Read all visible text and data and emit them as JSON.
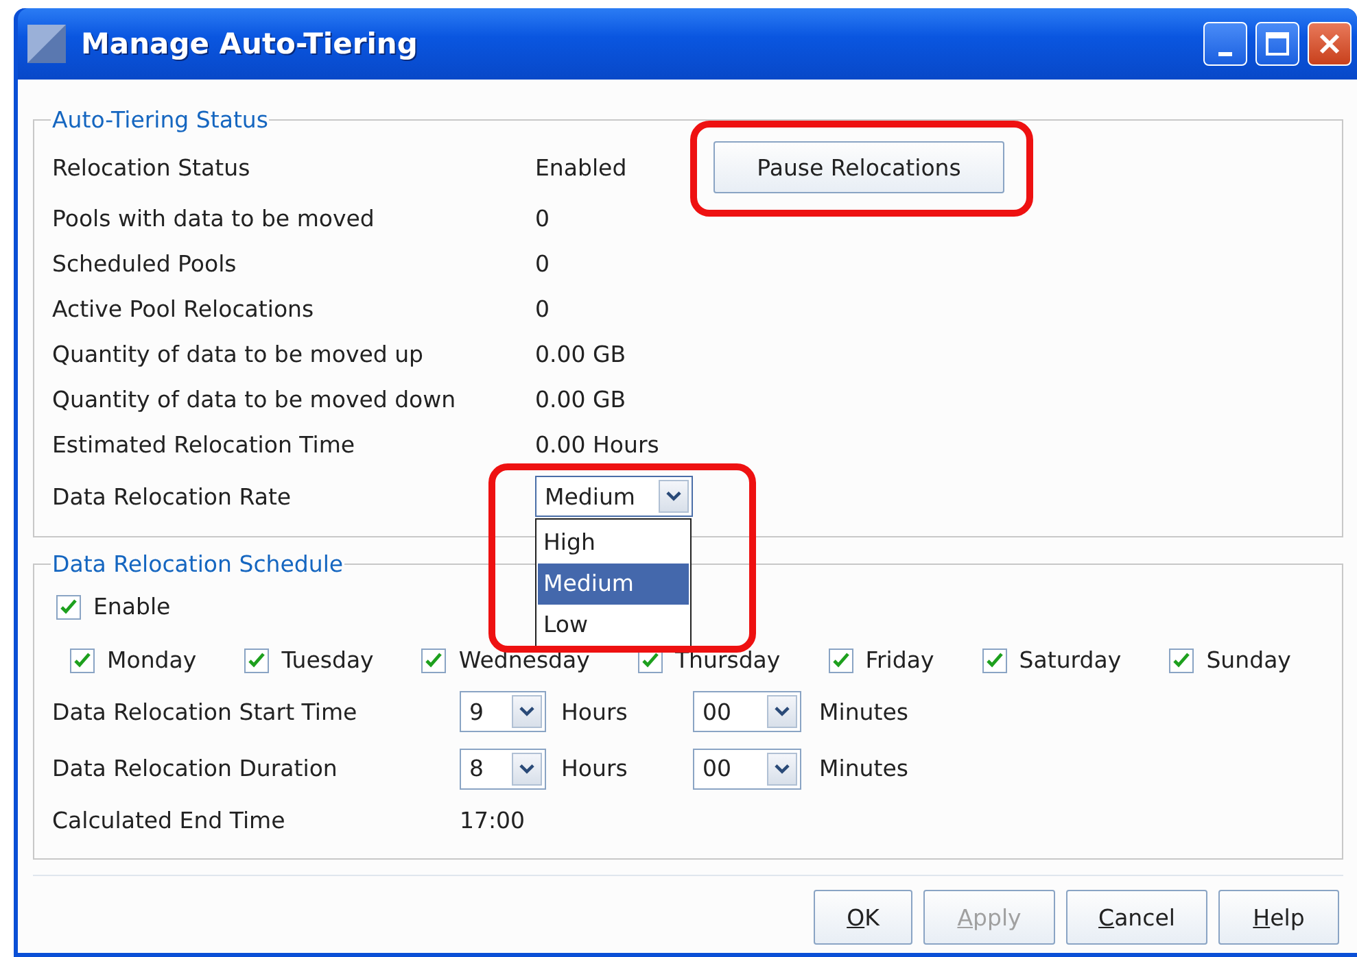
{
  "window": {
    "title": "Manage Auto-Tiering"
  },
  "status_group": {
    "title": "Auto-Tiering Status",
    "rows": [
      {
        "label": "Relocation Status",
        "value": "Enabled"
      },
      {
        "label": "Pools with data to be moved",
        "value": "0"
      },
      {
        "label": "Scheduled Pools",
        "value": "0"
      },
      {
        "label": "Active Pool Relocations",
        "value": "0"
      },
      {
        "label": "Quantity of data to be moved up",
        "value": "0.00 GB"
      },
      {
        "label": "Quantity of data to be moved down",
        "value": "0.00 GB"
      },
      {
        "label": "Estimated Relocation Time",
        "value": "0.00 Hours"
      }
    ],
    "pause_button": "Pause Relocations",
    "rate": {
      "label": "Data Relocation Rate",
      "value": "Medium",
      "expanded": true,
      "options": [
        {
          "label": "High",
          "selected": false
        },
        {
          "label": "Medium",
          "selected": true
        },
        {
          "label": "Low",
          "selected": false
        }
      ]
    }
  },
  "schedule": {
    "title": "Data Relocation Schedule",
    "enable": {
      "label": "Enable",
      "checked": true
    },
    "days": [
      {
        "label": "Monday",
        "checked": true
      },
      {
        "label": "Tuesday",
        "checked": true
      },
      {
        "label": "Wednesday",
        "checked": true
      },
      {
        "label": "Thursday",
        "checked": true
      },
      {
        "label": "Friday",
        "checked": true
      },
      {
        "label": "Saturday",
        "checked": true
      },
      {
        "label": "Sunday",
        "checked": true
      }
    ],
    "times": [
      {
        "label": "Data Relocation Start Time",
        "hours": "9",
        "hours_unit": "Hours",
        "minutes": "00",
        "minutes_unit": "Minutes"
      },
      {
        "label": "Data Relocation Duration",
        "hours": "8",
        "hours_unit": "Hours",
        "minutes": "00",
        "minutes_unit": "Minutes"
      }
    ],
    "end_time": {
      "label": "Calculated End Time",
      "value": "17:00"
    }
  },
  "buttons": [
    {
      "label": "OK",
      "disabled": false
    },
    {
      "label": "Apply",
      "disabled": true
    },
    {
      "label": "Cancel",
      "disabled": false
    },
    {
      "label": "Help",
      "disabled": false
    }
  ]
}
